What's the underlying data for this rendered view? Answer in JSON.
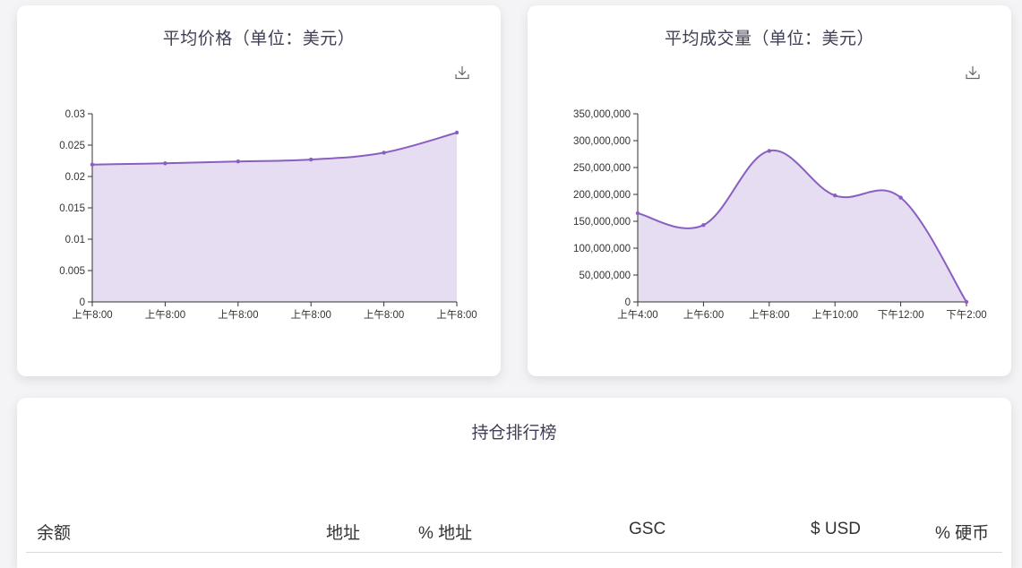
{
  "price_card": {
    "title": "平均价格（单位：美元）",
    "download_icon": "download-icon"
  },
  "volume_card": {
    "title": "平均成交量（单位：美元）",
    "download_icon": "download-icon"
  },
  "holders": {
    "title": "持仓排行榜",
    "columns": [
      "余额",
      "地址",
      "% 地址",
      "GSC",
      "$ USD",
      "% 硬币"
    ]
  },
  "chart_data": [
    {
      "type": "area",
      "title": "平均价格（单位：美元）",
      "x": [
        "上午8:00",
        "上午8:00",
        "上午8:00",
        "上午8:00",
        "上午8:00",
        "上午8:00"
      ],
      "xticks": [
        "上午8:00",
        "上午8:00",
        "上午8:00",
        "上午8:00",
        "上午8:00",
        "上午8:00"
      ],
      "series": [
        {
          "values": [
            0.0219,
            0.0221,
            0.0224,
            0.0227,
            0.0238,
            0.027
          ]
        }
      ],
      "yticks": [
        "0",
        "0.005",
        "0.01",
        "0.015",
        "0.02",
        "0.025",
        "0.03"
      ],
      "ylim": [
        0,
        0.03
      ],
      "color": "#8a5fc0",
      "fill": "#e6ddf2"
    },
    {
      "type": "area",
      "title": "平均成交量（单位：美元）",
      "x": [
        "上午4:00",
        "上午6:00",
        "上午8:00",
        "上午10:00",
        "下午12:00",
        "下午2:00"
      ],
      "xticks": [
        "上午4:00",
        "上午6:00",
        "上午8:00",
        "上午10:00",
        "下午12:00",
        "下午2:00"
      ],
      "series": [
        {
          "values": [
            165000000,
            143000000,
            281000000,
            198000000,
            194000000,
            0
          ]
        }
      ],
      "yticks": [
        "0",
        "50,000,000",
        "100,000,000",
        "150,000,000",
        "200,000,000",
        "250,000,000",
        "300,000,000",
        "350,000,000"
      ],
      "ylim": [
        0,
        350000000
      ],
      "color": "#8a5fc0",
      "fill": "#e6ddf2"
    }
  ]
}
